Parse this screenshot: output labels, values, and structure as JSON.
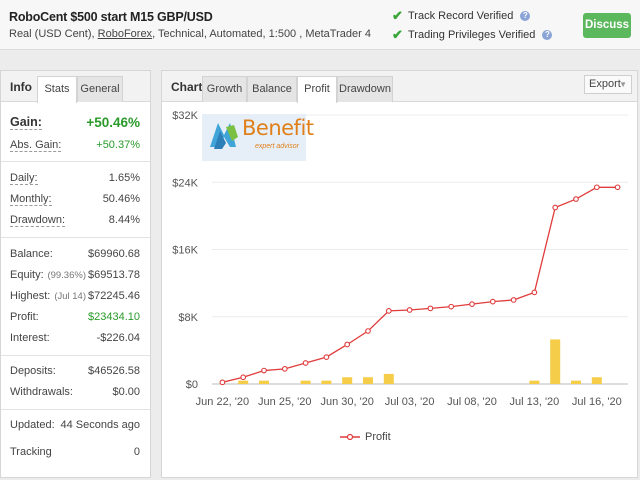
{
  "header": {
    "title": "RoboCent $500 start M15 GBP/USD",
    "subtitle_prefix": "Real (USD Cent),",
    "broker": "RoboForex",
    "subtitle_suffix": ", Technical, Automated, 1:500 , MetaTrader 4",
    "verified_track": "Track Record Verified",
    "verified_trading": "Trading Privileges Verified",
    "discuss": "Discuss"
  },
  "left": {
    "title": "Info",
    "tabs": [
      "Stats",
      "General"
    ],
    "gain_label": "Gain:",
    "gain": "+50.46%",
    "abs_gain_label": "Abs. Gain:",
    "abs_gain": "+50.37%",
    "daily_label": "Daily:",
    "daily": "1.65%",
    "monthly_label": "Monthly:",
    "monthly": "50.46%",
    "drawdown_label": "Drawdown:",
    "drawdown": "8.44%",
    "balance_label": "Balance:",
    "balance": "$69960.68",
    "equity_label": "Equity:",
    "equity_note": "(99.36%)",
    "equity": "$69513.78",
    "highest_label": "Highest:",
    "highest_note": "(Jul 14)",
    "highest": "$72245.46",
    "profit_label": "Profit:",
    "profit": "$23434.10",
    "interest_label": "Interest:",
    "interest": "-$226.04",
    "deposits_label": "Deposits:",
    "deposits": "$46526.58",
    "withdrawals_label": "Withdrawals:",
    "withdrawals": "$0.00",
    "updated_label": "Updated:",
    "updated": "44 Seconds ago",
    "tracking_label": "Tracking",
    "tracking": "0"
  },
  "right": {
    "title": "Chart",
    "tabs": [
      "Growth",
      "Balance",
      "Profit",
      "Drawdown"
    ],
    "active_tab": "Profit",
    "export": "Export",
    "logo_text": "Benefit",
    "logo_tag": "expert advisor"
  },
  "colors": {
    "line": "#e03c3c",
    "bar": "#f5cd48",
    "accent_green": "#5cb85c"
  },
  "chart_data": {
    "type": "line",
    "y_tick_labels": [
      "$0",
      "$8K",
      "$16K",
      "$24K",
      "$32K"
    ],
    "y_ticks": [
      0,
      8000,
      16000,
      24000,
      32000
    ],
    "ylim": [
      0,
      32000
    ],
    "x_tick_labels": [
      "Jun 22, '20",
      "Jun 25, '20",
      "Jun 30, '20",
      "Jul 03, '20",
      "Jul 08, '20",
      "Jul 13, '20",
      "Jul 16, '20"
    ],
    "x_tick_index": [
      0,
      3,
      6,
      9,
      12,
      15,
      18
    ],
    "series": [
      {
        "name": "Profit",
        "values": [
          200,
          800,
          1600,
          1800,
          2500,
          3200,
          4700,
          6300,
          8700,
          8800,
          9000,
          9200,
          9500,
          9800,
          10000,
          10900,
          21000,
          22000,
          23400,
          23400
        ]
      },
      {
        "bars": [
          0,
          400,
          400,
          0,
          400,
          400,
          800,
          800,
          1200,
          0,
          0,
          0,
          0,
          0,
          0,
          400,
          5300,
          400,
          800,
          0
        ]
      }
    ]
  }
}
